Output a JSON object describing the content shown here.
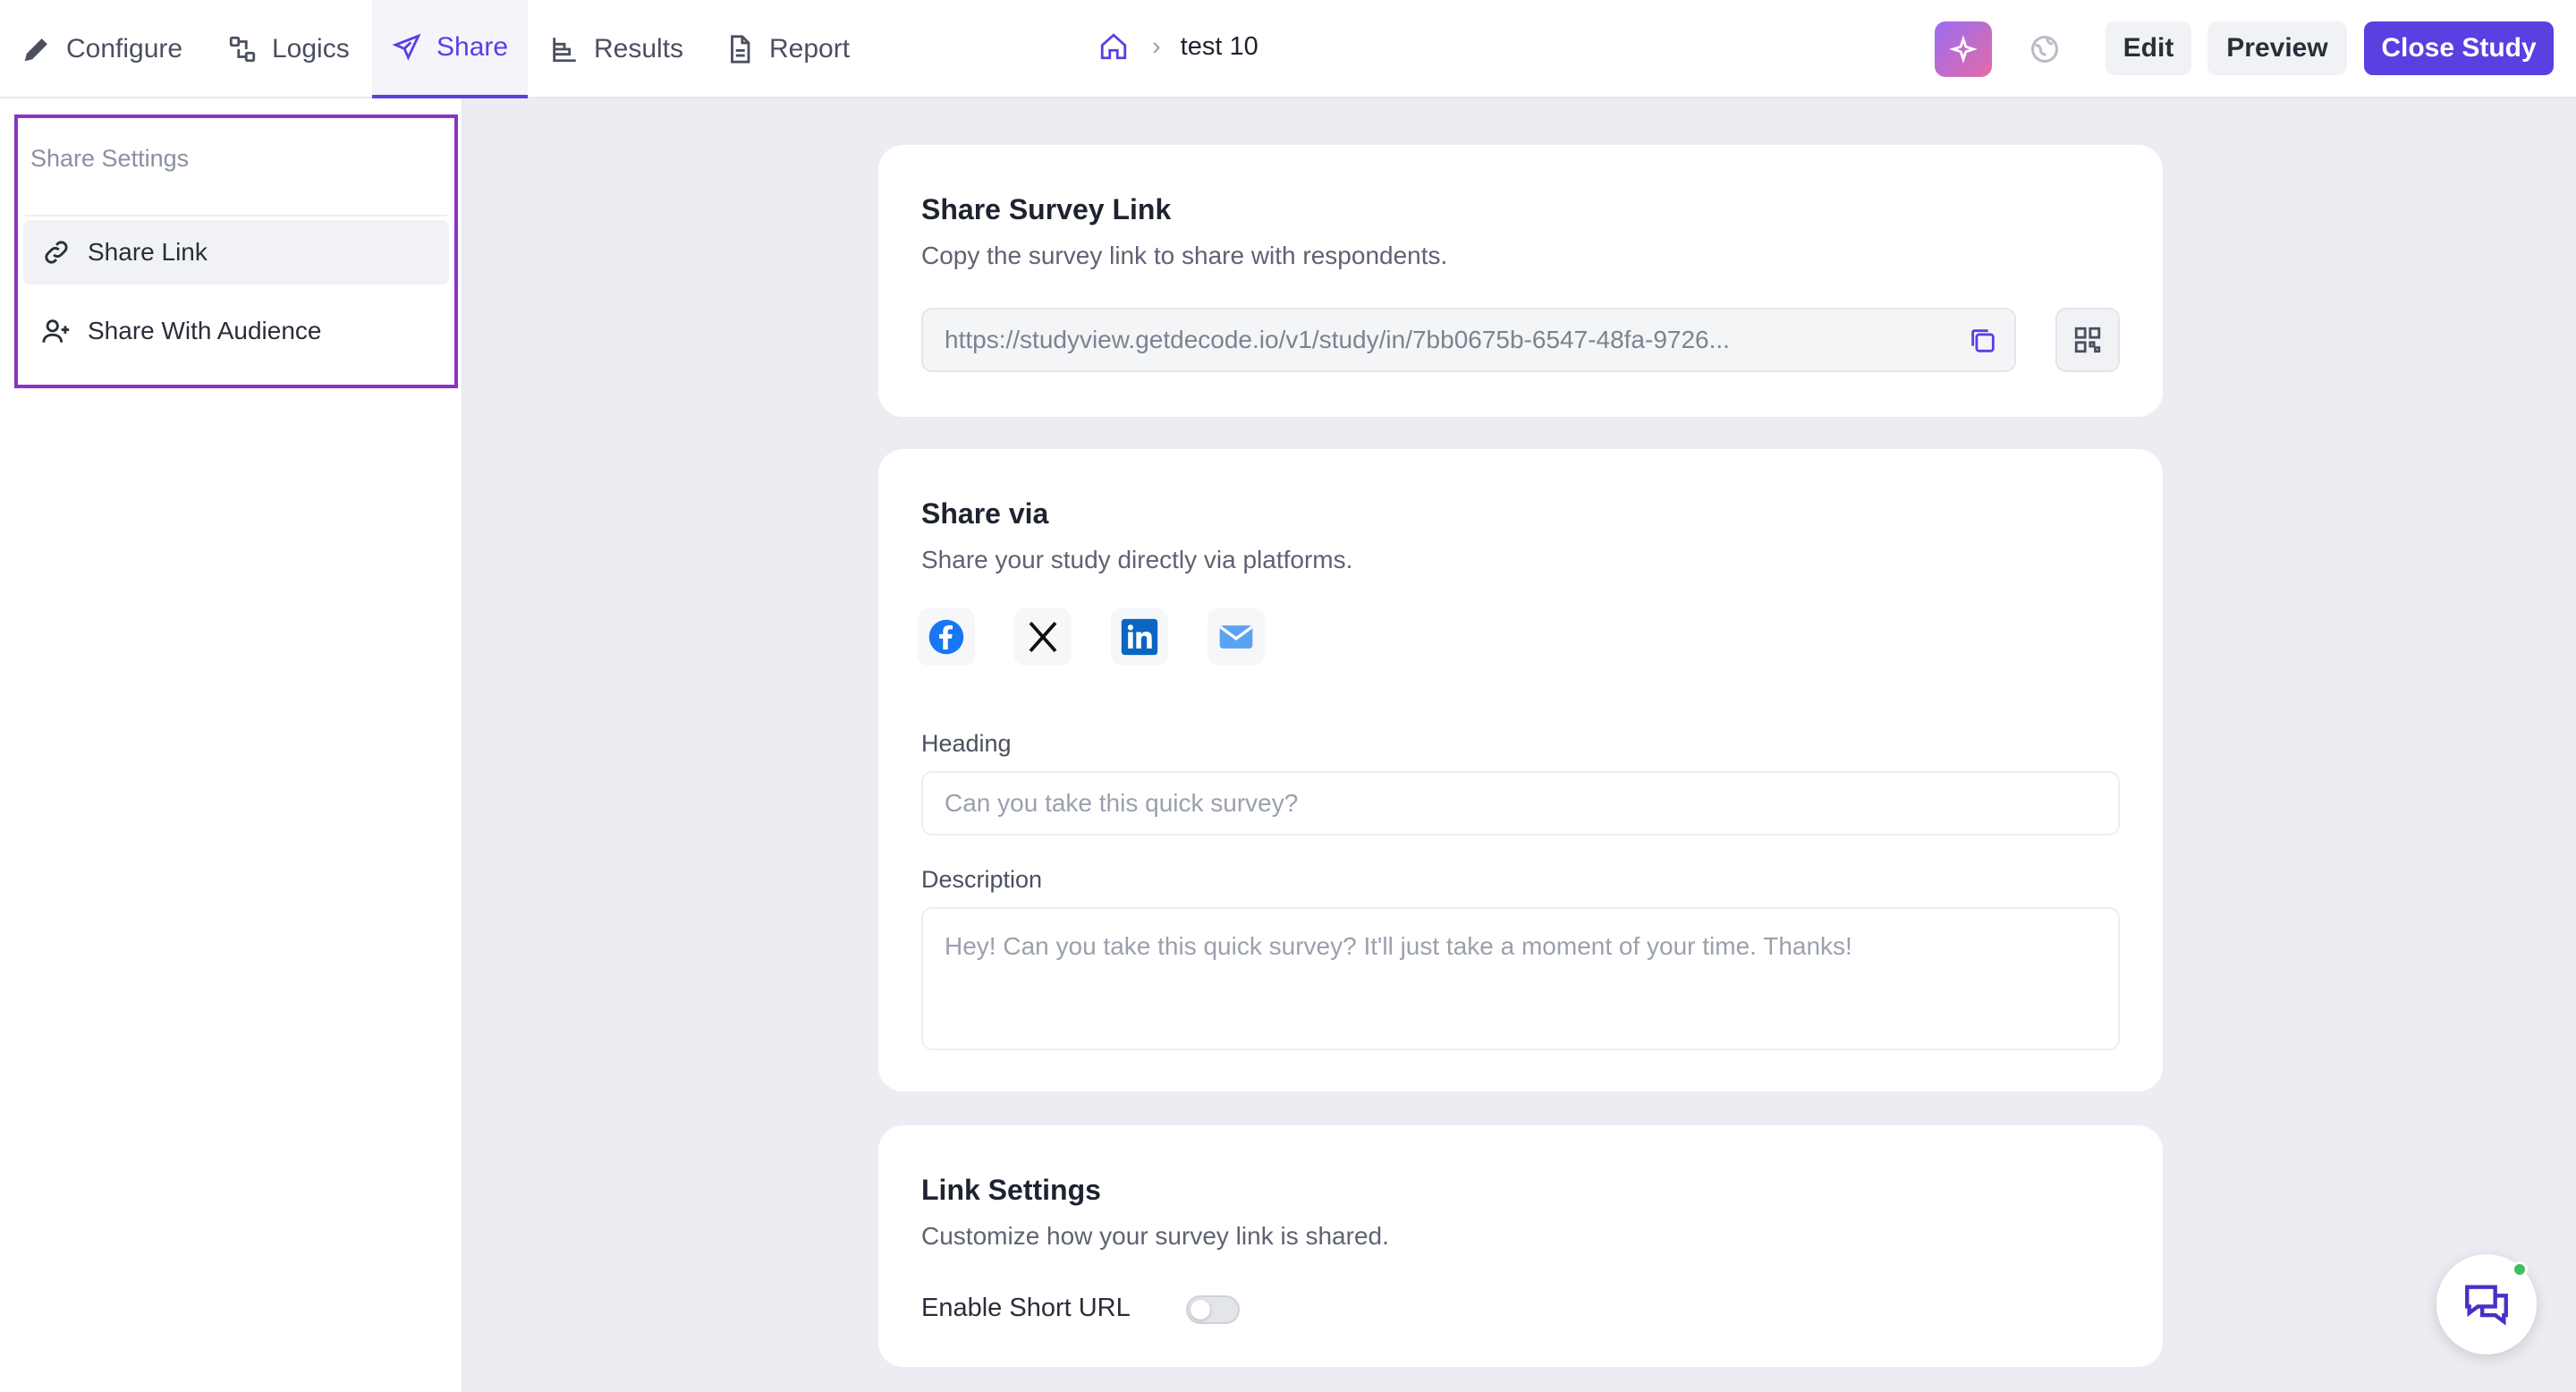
{
  "topbar": {
    "tabs": [
      {
        "label": "Configure",
        "icon": "pencil-icon"
      },
      {
        "label": "Logics",
        "icon": "logic-icon"
      },
      {
        "label": "Share",
        "icon": "send-icon",
        "active": true
      },
      {
        "label": "Results",
        "icon": "bar-chart-icon"
      },
      {
        "label": "Report",
        "icon": "document-icon"
      }
    ],
    "breadcrumb": {
      "home_icon": "home-icon",
      "separator": "›",
      "study": "test 10"
    },
    "buttons": {
      "edit": "Edit",
      "preview": "Preview",
      "close": "Close Study"
    }
  },
  "sidebar": {
    "title": "Share Settings",
    "items": [
      {
        "label": "Share Link",
        "icon": "link-icon",
        "active": true
      },
      {
        "label": "Share With Audience",
        "icon": "user-plus-icon"
      }
    ]
  },
  "share_link": {
    "title": "Share Survey Link",
    "subtitle": "Copy the survey link to share with respondents.",
    "url": "https://studyview.getdecode.io/v1/study/in/7bb0675b-6547-48fa-9726..."
  },
  "share_via": {
    "title": "Share via",
    "subtitle": "Share your study directly via platforms.",
    "platforms": [
      "facebook-icon",
      "x-icon",
      "linkedin-icon",
      "mail-icon"
    ],
    "heading_label": "Heading",
    "heading_placeholder": "Can you take this quick survey?",
    "description_label": "Description",
    "description_placeholder": "Hey! Can you take this quick survey? It'll just take a moment of your time. Thanks!"
  },
  "link_settings": {
    "title": "Link Settings",
    "subtitle": "Customize how your survey link is shared.",
    "short_url_label": "Enable Short URL",
    "short_url_enabled": false
  },
  "colors": {
    "accent": "#5b3fe0",
    "highlight_border": "#8a33c4",
    "background": "#ecedf2"
  }
}
